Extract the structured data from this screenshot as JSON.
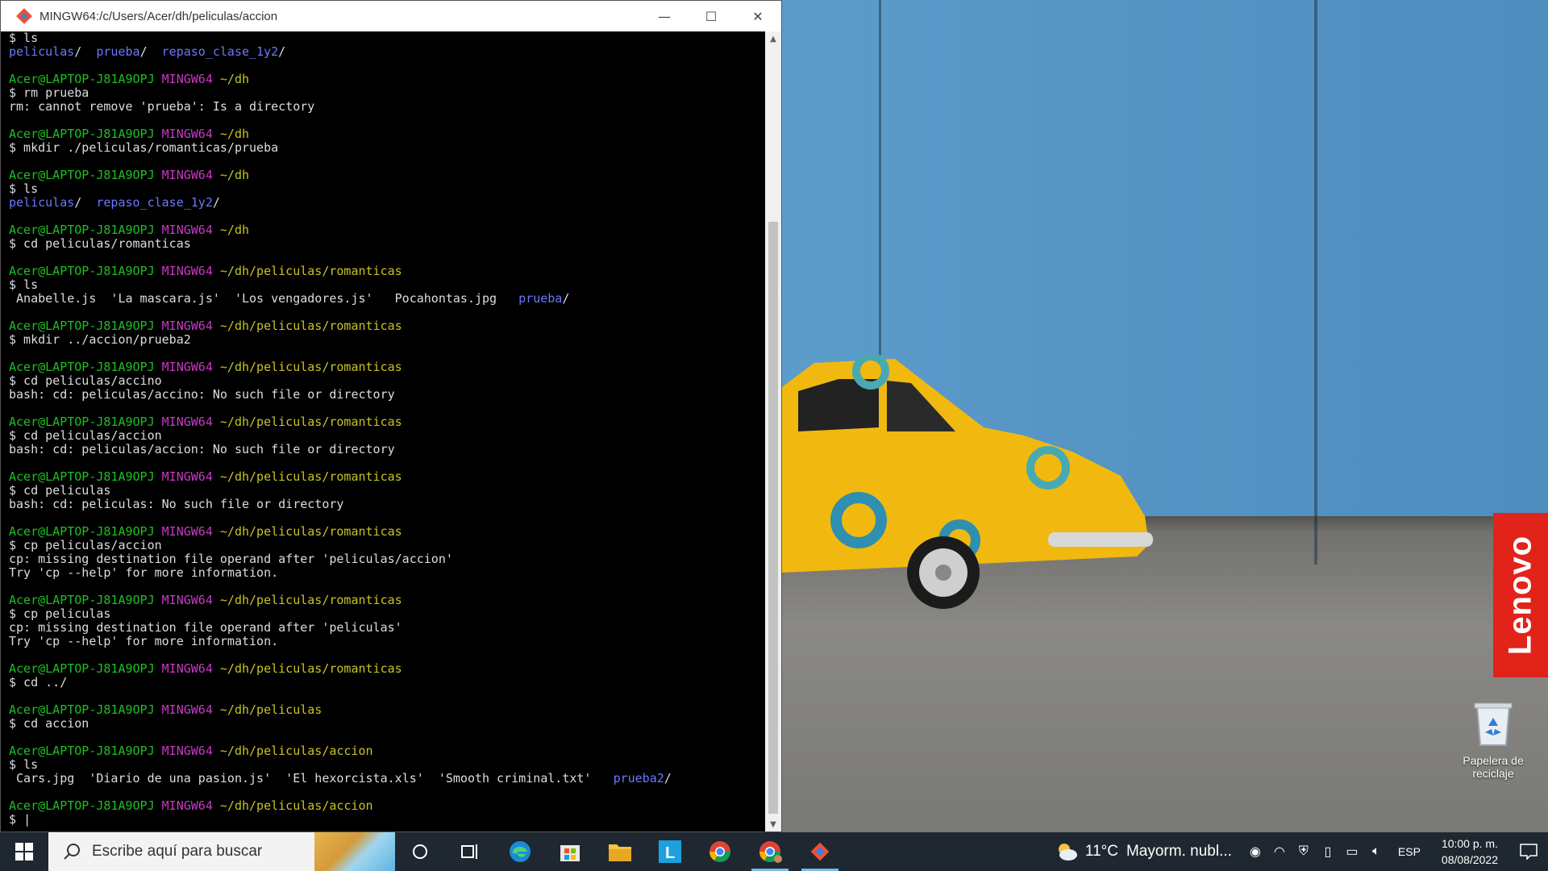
{
  "window": {
    "title": "MINGW64:/c/Users/Acer/dh/peliculas/accion",
    "minimize": "—",
    "maximize": "☐",
    "close": "✕"
  },
  "terminal": {
    "lines": [
      [
        {
          "t": "$ ls",
          "c": ""
        }
      ],
      [
        {
          "t": "peliculas",
          "c": "blue"
        },
        {
          "t": "/  ",
          "c": ""
        },
        {
          "t": "prueba",
          "c": "blue"
        },
        {
          "t": "/  ",
          "c": ""
        },
        {
          "t": "repaso_clase_1y2",
          "c": "blue"
        },
        {
          "t": "/",
          "c": ""
        }
      ],
      [],
      [
        {
          "t": "Acer@LAPTOP-J81A9OPJ ",
          "c": "green"
        },
        {
          "t": "MINGW64 ",
          "c": "magenta"
        },
        {
          "t": "~/dh",
          "c": "yellow"
        }
      ],
      [
        {
          "t": "$ rm prueba",
          "c": ""
        }
      ],
      [
        {
          "t": "rm: cannot remove 'prueba': Is a directory",
          "c": ""
        }
      ],
      [],
      [
        {
          "t": "Acer@LAPTOP-J81A9OPJ ",
          "c": "green"
        },
        {
          "t": "MINGW64 ",
          "c": "magenta"
        },
        {
          "t": "~/dh",
          "c": "yellow"
        }
      ],
      [
        {
          "t": "$ mkdir ./peliculas/romanticas/prueba",
          "c": ""
        }
      ],
      [],
      [
        {
          "t": "Acer@LAPTOP-J81A9OPJ ",
          "c": "green"
        },
        {
          "t": "MINGW64 ",
          "c": "magenta"
        },
        {
          "t": "~/dh",
          "c": "yellow"
        }
      ],
      [
        {
          "t": "$ ls",
          "c": ""
        }
      ],
      [
        {
          "t": "peliculas",
          "c": "blue"
        },
        {
          "t": "/  ",
          "c": ""
        },
        {
          "t": "repaso_clase_1y2",
          "c": "blue"
        },
        {
          "t": "/",
          "c": ""
        }
      ],
      [],
      [
        {
          "t": "Acer@LAPTOP-J81A9OPJ ",
          "c": "green"
        },
        {
          "t": "MINGW64 ",
          "c": "magenta"
        },
        {
          "t": "~/dh",
          "c": "yellow"
        }
      ],
      [
        {
          "t": "$ cd peliculas/romanticas",
          "c": ""
        }
      ],
      [],
      [
        {
          "t": "Acer@LAPTOP-J81A9OPJ ",
          "c": "green"
        },
        {
          "t": "MINGW64 ",
          "c": "magenta"
        },
        {
          "t": "~/dh/peliculas/romanticas",
          "c": "yellow"
        }
      ],
      [
        {
          "t": "$ ls",
          "c": ""
        }
      ],
      [
        {
          "t": " Anabelle.js  'La mascara.js'  'Los vengadores.js'   Pocahontas.jpg   ",
          "c": ""
        },
        {
          "t": "prueba",
          "c": "blue"
        },
        {
          "t": "/",
          "c": ""
        }
      ],
      [],
      [
        {
          "t": "Acer@LAPTOP-J81A9OPJ ",
          "c": "green"
        },
        {
          "t": "MINGW64 ",
          "c": "magenta"
        },
        {
          "t": "~/dh/peliculas/romanticas",
          "c": "yellow"
        }
      ],
      [
        {
          "t": "$ mkdir ../accion/prueba2",
          "c": ""
        }
      ],
      [],
      [
        {
          "t": "Acer@LAPTOP-J81A9OPJ ",
          "c": "green"
        },
        {
          "t": "MINGW64 ",
          "c": "magenta"
        },
        {
          "t": "~/dh/peliculas/romanticas",
          "c": "yellow"
        }
      ],
      [
        {
          "t": "$ cd peliculas/accino",
          "c": ""
        }
      ],
      [
        {
          "t": "bash: cd: peliculas/accino: No such file or directory",
          "c": ""
        }
      ],
      [],
      [
        {
          "t": "Acer@LAPTOP-J81A9OPJ ",
          "c": "green"
        },
        {
          "t": "MINGW64 ",
          "c": "magenta"
        },
        {
          "t": "~/dh/peliculas/romanticas",
          "c": "yellow"
        }
      ],
      [
        {
          "t": "$ cd peliculas/accion",
          "c": ""
        }
      ],
      [
        {
          "t": "bash: cd: peliculas/accion: No such file or directory",
          "c": ""
        }
      ],
      [],
      [
        {
          "t": "Acer@LAPTOP-J81A9OPJ ",
          "c": "green"
        },
        {
          "t": "MINGW64 ",
          "c": "magenta"
        },
        {
          "t": "~/dh/peliculas/romanticas",
          "c": "yellow"
        }
      ],
      [
        {
          "t": "$ cd peliculas",
          "c": ""
        }
      ],
      [
        {
          "t": "bash: cd: peliculas: No such file or directory",
          "c": ""
        }
      ],
      [],
      [
        {
          "t": "Acer@LAPTOP-J81A9OPJ ",
          "c": "green"
        },
        {
          "t": "MINGW64 ",
          "c": "magenta"
        },
        {
          "t": "~/dh/peliculas/romanticas",
          "c": "yellow"
        }
      ],
      [
        {
          "t": "$ cp peliculas/accion",
          "c": ""
        }
      ],
      [
        {
          "t": "cp: missing destination file operand after 'peliculas/accion'",
          "c": ""
        }
      ],
      [
        {
          "t": "Try 'cp --help' for more information.",
          "c": ""
        }
      ],
      [],
      [
        {
          "t": "Acer@LAPTOP-J81A9OPJ ",
          "c": "green"
        },
        {
          "t": "MINGW64 ",
          "c": "magenta"
        },
        {
          "t": "~/dh/peliculas/romanticas",
          "c": "yellow"
        }
      ],
      [
        {
          "t": "$ cp peliculas",
          "c": ""
        }
      ],
      [
        {
          "t": "cp: missing destination file operand after 'peliculas'",
          "c": ""
        }
      ],
      [
        {
          "t": "Try 'cp --help' for more information.",
          "c": ""
        }
      ],
      [],
      [
        {
          "t": "Acer@LAPTOP-J81A9OPJ ",
          "c": "green"
        },
        {
          "t": "MINGW64 ",
          "c": "magenta"
        },
        {
          "t": "~/dh/peliculas/romanticas",
          "c": "yellow"
        }
      ],
      [
        {
          "t": "$ cd ../",
          "c": ""
        }
      ],
      [],
      [
        {
          "t": "Acer@LAPTOP-J81A9OPJ ",
          "c": "green"
        },
        {
          "t": "MINGW64 ",
          "c": "magenta"
        },
        {
          "t": "~/dh/peliculas",
          "c": "yellow"
        }
      ],
      [
        {
          "t": "$ cd accion",
          "c": ""
        }
      ],
      [],
      [
        {
          "t": "Acer@LAPTOP-J81A9OPJ ",
          "c": "green"
        },
        {
          "t": "MINGW64 ",
          "c": "magenta"
        },
        {
          "t": "~/dh/peliculas/accion",
          "c": "yellow"
        }
      ],
      [
        {
          "t": "$ ls",
          "c": ""
        }
      ],
      [
        {
          "t": " Cars.jpg  'Diario de una pasion.js'  'El hexorcista.xls'  'Smooth criminal.txt'   ",
          "c": ""
        },
        {
          "t": "prueba2",
          "c": "blue"
        },
        {
          "t": "/",
          "c": ""
        }
      ],
      [],
      [
        {
          "t": "Acer@LAPTOP-J81A9OPJ ",
          "c": "green"
        },
        {
          "t": "MINGW64 ",
          "c": "magenta"
        },
        {
          "t": "~/dh/peliculas/accion",
          "c": "yellow"
        }
      ],
      [
        {
          "t": "$ ",
          "c": ""
        },
        {
          "t": "|",
          "c": "cursor"
        }
      ]
    ]
  },
  "desktop": {
    "brand": "Lenovo",
    "recycle_bin_label": "Papelera de reciclaje"
  },
  "taskbar": {
    "search_placeholder": "Escribe aquí para buscar",
    "apps": [
      "cortana-icon",
      "task-view-icon",
      "edge-icon",
      "store-icon",
      "file-explorer-icon",
      "l-app-icon",
      "chrome-icon",
      "chrome-profile-icon",
      "git-bash-icon"
    ],
    "weather_temp": "11°C",
    "weather_text": "Mayorm. nubl...",
    "language": "ESP",
    "time": "10:00 p. m.",
    "date": "08/08/2022"
  },
  "colors": {
    "prompt_user": "#1dc121",
    "prompt_host": "#c839c5",
    "prompt_path": "#c7c423",
    "directory": "#6a78ff",
    "taskbar_bg": "#1f2830",
    "lenovo_red": "#e2231a"
  }
}
